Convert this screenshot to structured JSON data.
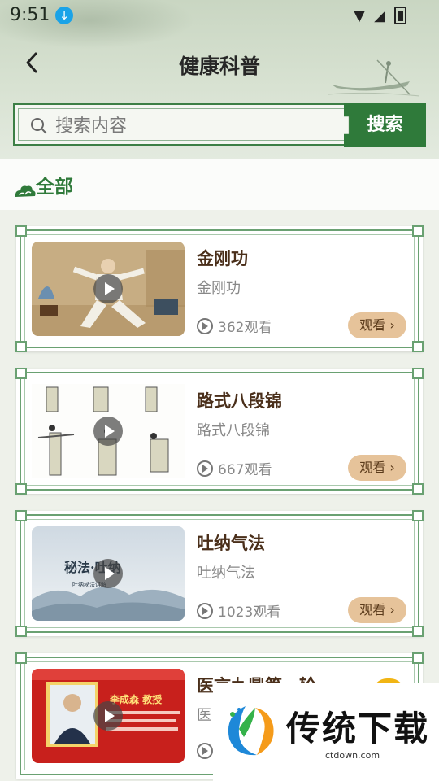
{
  "status_bar": {
    "time": "9:51"
  },
  "header": {
    "title": "健康科普"
  },
  "search": {
    "placeholder": "搜索内容",
    "button_label": "搜索"
  },
  "category": {
    "label": "全部"
  },
  "videos": [
    {
      "title": "金刚功",
      "subtitle": "金刚功",
      "views": "362观看",
      "watch_label": "观看"
    },
    {
      "title": "路式八段锦",
      "subtitle": "路式八段锦",
      "views": "667观看",
      "watch_label": "观看"
    },
    {
      "title": "吐纳气法",
      "subtitle": "吐纳气法",
      "views": "1023观看",
      "watch_label": "观看"
    },
    {
      "title": "医言九鼎第一轮",
      "subtitle": "医",
      "views": "",
      "watch_label": ""
    }
  ],
  "thumbnail_texts": {
    "tuna_main": "秘法·吐纳",
    "tuna_sub": "吐纳秘法讲解",
    "doctor_name": "李成森 教授"
  },
  "watermark": {
    "brand": "传统下载",
    "url": "ctdown.com"
  },
  "colors": {
    "primary_green": "#2f7a3a",
    "watch_button": "#e6c39a",
    "title_brown": "#4a2f1a"
  }
}
